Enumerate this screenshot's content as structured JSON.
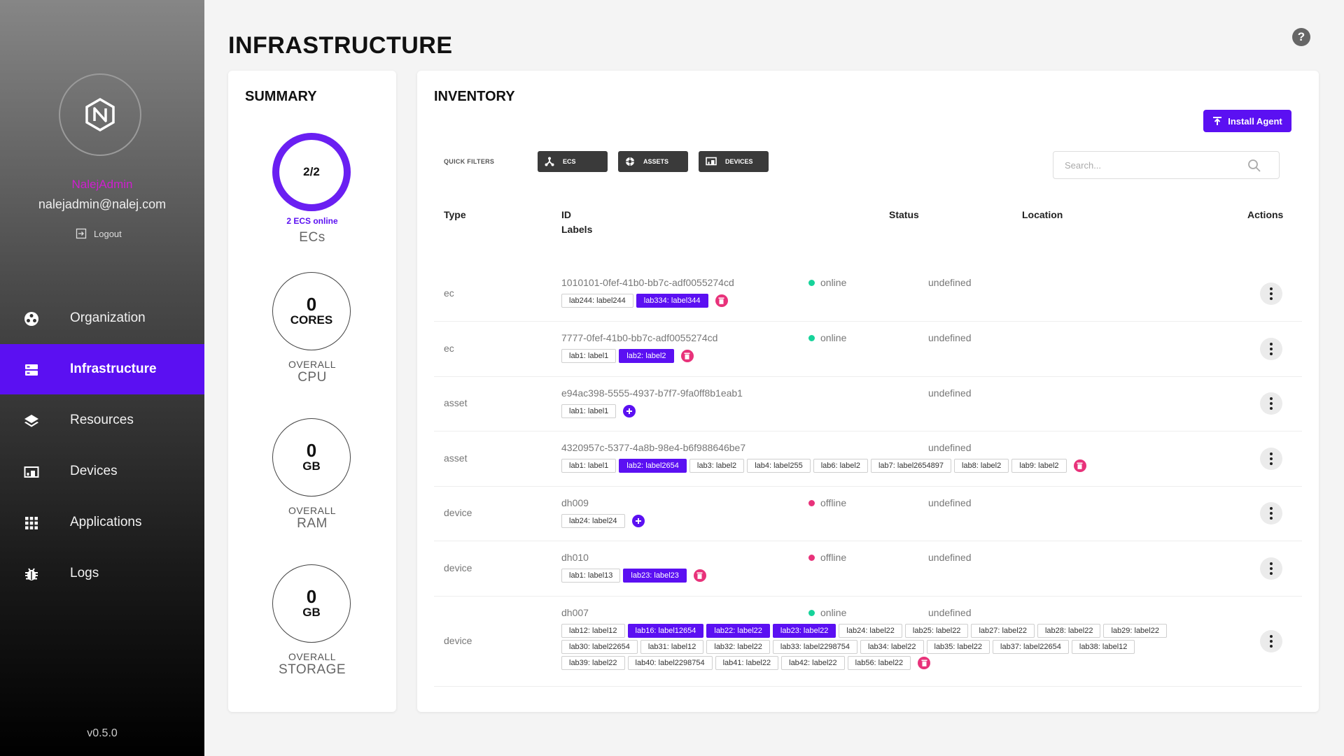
{
  "sidebar": {
    "user_name": "NalejAdmin",
    "user_email": "nalejadmin@nalej.com",
    "logout_label": "Logout",
    "version": "v0.5.0",
    "items": [
      {
        "label": "Organization",
        "icon": "organization-icon",
        "active": false
      },
      {
        "label": "Infrastructure",
        "icon": "infrastructure-icon",
        "active": true
      },
      {
        "label": "Resources",
        "icon": "layers-icon",
        "active": false
      },
      {
        "label": "Devices",
        "icon": "devices-icon",
        "active": false
      },
      {
        "label": "Applications",
        "icon": "grid-icon",
        "active": false
      },
      {
        "label": "Logs",
        "icon": "bug-icon",
        "active": false
      }
    ]
  },
  "header": {
    "title": "INFRASTRUCTURE",
    "help_label": "?"
  },
  "summary": {
    "title": "SUMMARY",
    "ecs": {
      "value": "2/2",
      "sub": "2 ECS online",
      "caption": "ECs"
    },
    "cpu": {
      "value": "0",
      "unit": "CORES",
      "caption1": "OVERALL",
      "caption2": "CPU"
    },
    "ram": {
      "value": "0",
      "unit": "GB",
      "caption1": "OVERALL",
      "caption2": "RAM"
    },
    "storage": {
      "value": "0",
      "unit": "GB",
      "caption1": "OVERALL",
      "caption2": "STORAGE"
    }
  },
  "inventory": {
    "title": "INVENTORY",
    "install_label": "Install Agent",
    "quick_filters_label": "QUICK FILTERS",
    "filters": [
      {
        "label": "ECS",
        "icon": "ecs-icon"
      },
      {
        "label": "ASSETS",
        "icon": "assets-icon"
      },
      {
        "label": "DEVICES",
        "icon": "devices-icon"
      }
    ],
    "search_placeholder": "Search...",
    "columns": {
      "type": "Type",
      "id": "ID",
      "labels": "Labels",
      "status": "Status",
      "location": "Location",
      "actions": "Actions"
    },
    "rows": [
      {
        "type": "ec",
        "id": "1010101-0fef-41b0-bb7c-adf0055274cd",
        "status": "online",
        "location": "undefined",
        "action": "delete",
        "labels": [
          {
            "text": "lab244: label244",
            "selected": false
          },
          {
            "text": "lab334: label344",
            "selected": true
          }
        ]
      },
      {
        "type": "ec",
        "id": "7777-0fef-41b0-bb7c-adf0055274cd",
        "status": "online",
        "location": "undefined",
        "action": "delete",
        "labels": [
          {
            "text": "lab1: label1",
            "selected": false
          },
          {
            "text": "lab2: label2",
            "selected": true
          }
        ]
      },
      {
        "type": "asset",
        "id": "e94ac398-5555-4937-b7f7-9fa0ff8b1eab1",
        "status": "",
        "location": "undefined",
        "action": "add",
        "labels": [
          {
            "text": "lab1: label1",
            "selected": false
          }
        ]
      },
      {
        "type": "asset",
        "id": "4320957c-5377-4a8b-98e4-b6f988646be7",
        "status": "",
        "location": "undefined",
        "action": "delete",
        "labels": [
          {
            "text": "lab1: label1",
            "selected": false
          },
          {
            "text": "lab2: label2654",
            "selected": true
          },
          {
            "text": "lab3: label2",
            "selected": false
          },
          {
            "text": "lab4: label255",
            "selected": false
          },
          {
            "text": "lab6: label2",
            "selected": false
          },
          {
            "text": "lab7: label2654897",
            "selected": false
          },
          {
            "text": "lab8: label2",
            "selected": false
          },
          {
            "text": "lab9: label2",
            "selected": false
          }
        ]
      },
      {
        "type": "device",
        "id": "dh009",
        "status": "offline",
        "location": "undefined",
        "action": "add",
        "labels": [
          {
            "text": "lab24: label24",
            "selected": false
          }
        ]
      },
      {
        "type": "device",
        "id": "dh010",
        "status": "offline",
        "location": "undefined",
        "action": "delete",
        "labels": [
          {
            "text": "lab1: label13",
            "selected": false
          },
          {
            "text": "lab23: label23",
            "selected": true
          }
        ]
      },
      {
        "type": "device",
        "id": "dh007",
        "status": "online",
        "location": "undefined",
        "action": "delete",
        "labels": [
          {
            "text": "lab12: label12",
            "selected": false
          },
          {
            "text": "lab16: label12654",
            "selected": true
          },
          {
            "text": "lab22: label22",
            "selected": true
          },
          {
            "text": "lab23: label22",
            "selected": true
          },
          {
            "text": "lab24: label22",
            "selected": false
          },
          {
            "text": "lab25: label22",
            "selected": false
          },
          {
            "text": "lab27: label22",
            "selected": false
          },
          {
            "text": "lab28: label22",
            "selected": false
          },
          {
            "text": "lab29: label22",
            "selected": false
          },
          {
            "text": "lab30: label22654",
            "selected": false
          },
          {
            "text": "lab31: label12",
            "selected": false
          },
          {
            "text": "lab32: label22",
            "selected": false
          },
          {
            "text": "lab33: label2298754",
            "selected": false
          },
          {
            "text": "lab34: label22",
            "selected": false
          },
          {
            "text": "lab35: label22",
            "selected": false
          },
          {
            "text": "lab37: label22654",
            "selected": false
          },
          {
            "text": "lab38: label12",
            "selected": false
          },
          {
            "text": "lab39: label22",
            "selected": false
          },
          {
            "text": "lab40: label2298754",
            "selected": false
          },
          {
            "text": "lab41: label22",
            "selected": false
          },
          {
            "text": "lab42: label22",
            "selected": false
          },
          {
            "text": "lab56: label22",
            "selected": false
          }
        ]
      }
    ]
  }
}
